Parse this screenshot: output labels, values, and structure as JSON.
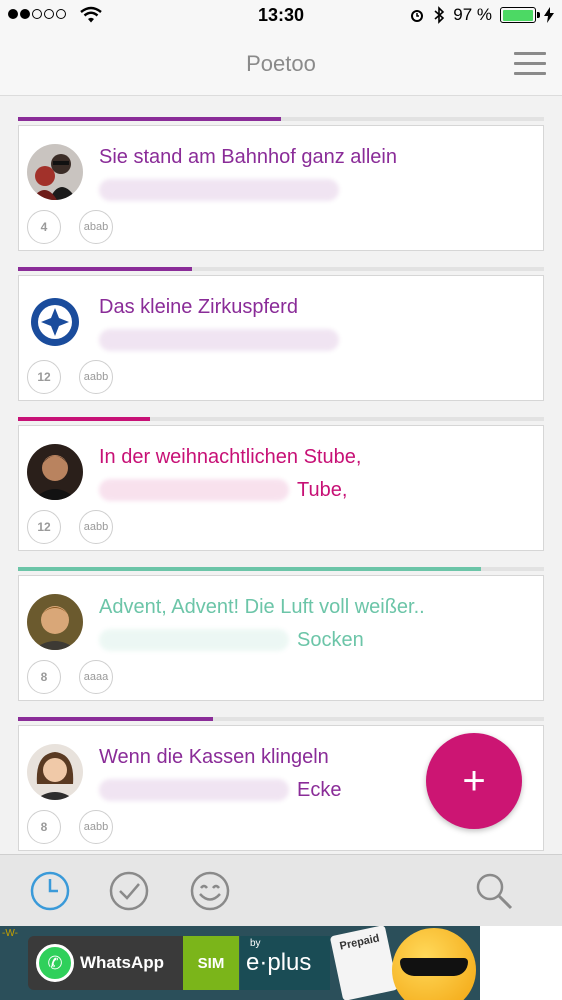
{
  "status_bar": {
    "time": "13:30",
    "battery_text": "97 %",
    "battery_level": 0.97
  },
  "navbar": {
    "title": "Poetoo"
  },
  "feed": [
    {
      "title_line": "Sie stand am Bahnhof ganz allein",
      "second_line_suffix": "",
      "count": "4",
      "rhyme_scheme": "abab",
      "color": "#8a2c98",
      "progress": 0.5,
      "avatar": "photo-couple"
    },
    {
      "title_line": "Das kleine Zirkuspferd",
      "second_line_suffix": "",
      "count": "12",
      "rhyme_scheme": "aabb",
      "color": "#8a2c98",
      "progress": 0.33,
      "avatar": "club-crest"
    },
    {
      "title_line": "In der weihnachtlichen Stube,",
      "second_line_suffix": "Tube,",
      "count": "12",
      "rhyme_scheme": "aabb",
      "color": "#c71176",
      "progress": 0.25,
      "avatar": "photo-man"
    },
    {
      "title_line": "Advent, Advent! Die Luft voll weißer..",
      "second_line_suffix": "Socken",
      "count": "8",
      "rhyme_scheme": "aaaa",
      "color": "#6cc5a8",
      "progress": 0.88,
      "avatar": "photo-young-man"
    },
    {
      "title_line": "Wenn die Kassen klingeln",
      "second_line_suffix": "Ecke",
      "count": "8",
      "rhyme_scheme": "aabb",
      "color": "#8a2c98",
      "progress": 0.37,
      "avatar": "photo-woman"
    }
  ],
  "fab": {
    "label": "+"
  },
  "tabbar": {
    "tabs": [
      "clock-icon",
      "check-icon",
      "smiley-icon",
      "search-icon"
    ],
    "active_color": "#3a9ad9"
  },
  "ad": {
    "brand": "WhatsApp",
    "sim": "SIM",
    "by": "by",
    "eplus": "e·plus",
    "prepaid": "Prepaid"
  }
}
